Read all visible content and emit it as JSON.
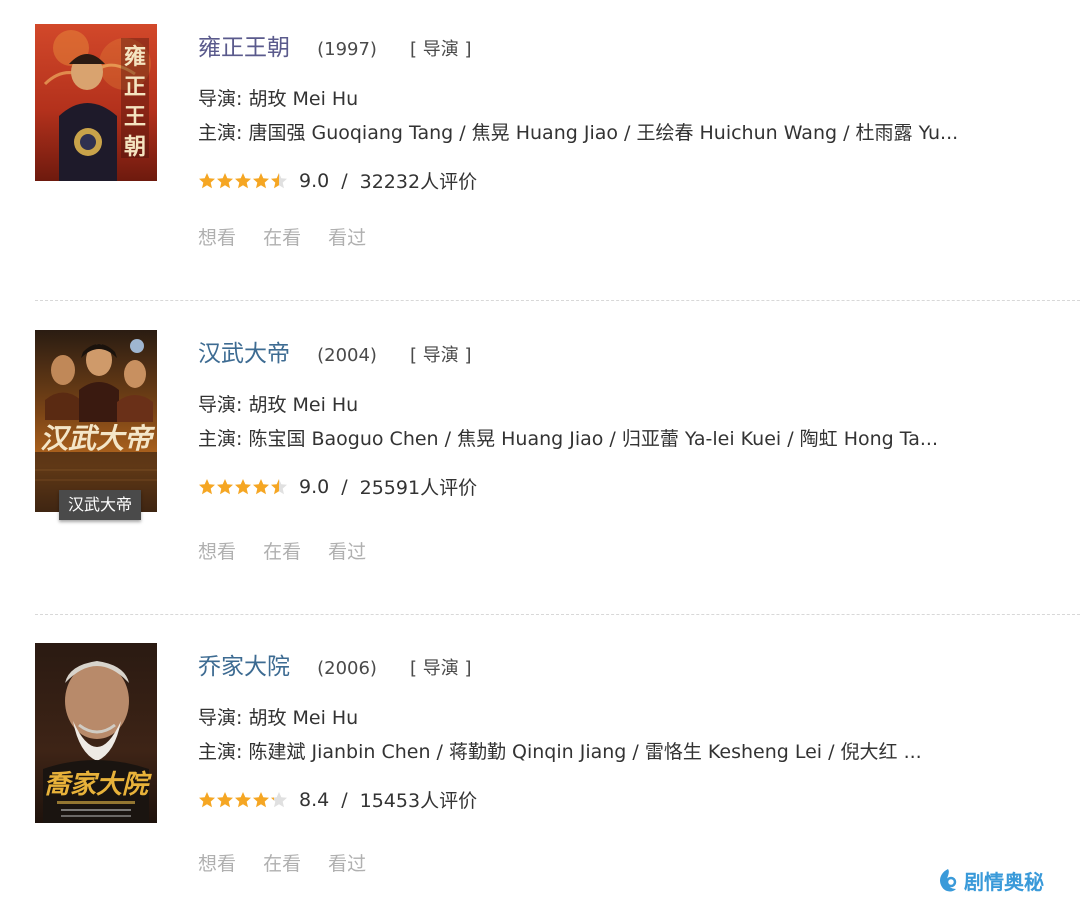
{
  "movies": [
    {
      "title": "雍正王朝",
      "year": "(1997)",
      "role": "[ 导演 ]",
      "director": "导演: 胡玫 Mei Hu",
      "cast": "主演: 唐国强 Guoqiang Tang / 焦晃 Huang Jiao / 王绘春 Huichun Wang / 杜雨露 Yu...",
      "rating_value": 9.0,
      "rating_text": "9.0",
      "rating_sep": "/",
      "votes": "32232人评价",
      "poster_caption": "",
      "actions": [
        "想看",
        "在看",
        "看过"
      ]
    },
    {
      "title": "汉武大帝",
      "year": "(2004)",
      "role": "[ 导演 ]",
      "director": "导演: 胡玫 Mei Hu",
      "cast": "主演: 陈宝国 Baoguo Chen / 焦晃 Huang Jiao / 归亚蕾 Ya-lei Kuei / 陶虹 Hong Ta...",
      "rating_value": 9.0,
      "rating_text": "9.0",
      "rating_sep": "/",
      "votes": "25591人评价",
      "poster_caption": "汉武大帝",
      "actions": [
        "想看",
        "在看",
        "看过"
      ]
    },
    {
      "title": "乔家大院",
      "year": "(2006)",
      "role": "[ 导演 ]",
      "director": "导演: 胡玫 Mei Hu",
      "cast": "主演: 陈建斌 Jianbin Chen / 蒋勤勤 Qinqin Jiang / 雷恪生 Kesheng Lei / 倪大红 ...",
      "rating_value": 8.4,
      "rating_text": "8.4",
      "rating_sep": "/",
      "votes": "15453人评价",
      "poster_caption": "",
      "actions": [
        "想看",
        "在看",
        "看过"
      ]
    }
  ],
  "colors": {
    "title_link": "#3d6b92",
    "title_visited": "#5a5a8c",
    "star": "#f5a623",
    "star_empty": "#e0e0e0",
    "action_text": "#b0b0b0",
    "watermark": "#3a9ad9"
  },
  "watermark": {
    "icon": "logo-icon",
    "text": "剧情奥秘"
  }
}
